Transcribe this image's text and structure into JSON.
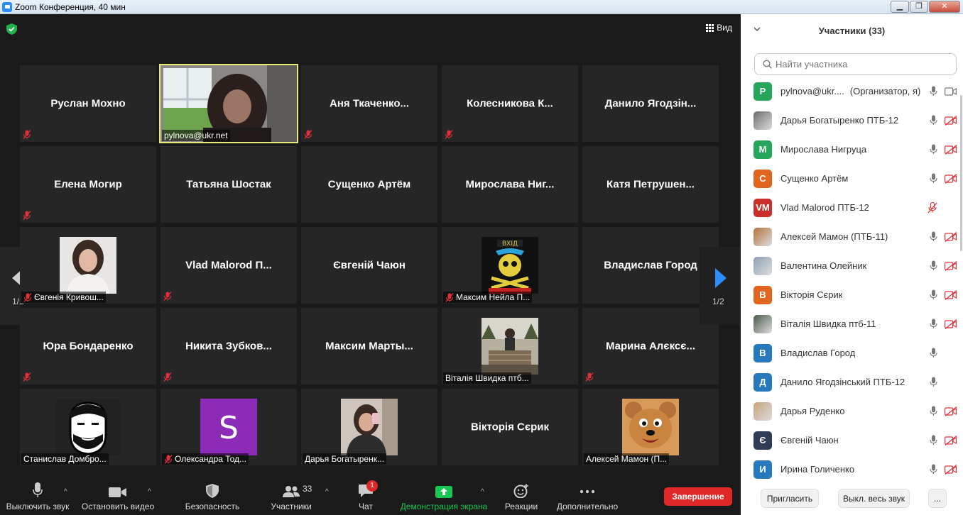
{
  "window": {
    "title": "Zoom Конференция, 40 мин",
    "btn_min": "▁",
    "btn_max": "❐",
    "btn_close": "✕"
  },
  "view_label": "Вид",
  "pager": {
    "page": "1/2"
  },
  "tiles": [
    {
      "name": "Руслан Мохно",
      "muted": true
    },
    {
      "label": "pylnova@ukr.net",
      "active": true,
      "photo": "webcam"
    },
    {
      "name": "Аня  Ткаченко...",
      "muted": true
    },
    {
      "name": "Колесникова  К...",
      "muted": true
    },
    {
      "name": "Данило  Ягодзін..."
    },
    {
      "name": "Елена Могир",
      "muted": true
    },
    {
      "name": "Татьяна Шостак"
    },
    {
      "name": "Сущенко Артём"
    },
    {
      "name": "Мирослава  Ниг..."
    },
    {
      "name": "Катя  Петрушен..."
    },
    {
      "label": "Євгенія Кривош...",
      "muted": true,
      "photo": "girl"
    },
    {
      "name": "Vlad  Malorod  П...",
      "muted": true
    },
    {
      "name": "Євгеній Чаюн"
    },
    {
      "label": "Максим Нейла П...",
      "muted": true,
      "photo": "skull"
    },
    {
      "name": "Владислав Город"
    },
    {
      "name": "Юра Бондаренко",
      "muted": true
    },
    {
      "name": "Никита  Зубков...",
      "muted": true
    },
    {
      "name": "Максим  Марты..."
    },
    {
      "label": "Віталія Швидка птб...",
      "photo": "outdoor"
    },
    {
      "name": "Марина  Алєксє...",
      "muted": true
    },
    {
      "label": "Станислав Домбро...",
      "photo": "beard"
    },
    {
      "label": "Олександра Тод...",
      "muted": true,
      "photo": "letter-s"
    },
    {
      "label": "Дарья Богатыренк...",
      "photo": "selfie"
    },
    {
      "name": "Вікторія Сєрик"
    },
    {
      "label": "Алексей Мамон (П...",
      "photo": "cartoon"
    }
  ],
  "toolbar": {
    "mute": "Выключить звук",
    "video": "Остановить видео",
    "security": "Безопасность",
    "participants": "Участники",
    "participants_count": "33",
    "chat": "Чат",
    "chat_badge": "1",
    "share": "Демонстрация экрана",
    "reactions": "Реакции",
    "more": "Дополнительно",
    "end": "Завершение",
    "caret": "^"
  },
  "panel": {
    "title": "Участники (33)",
    "search_placeholder": "Найти участника",
    "invite": "Пригласить",
    "mute_all": "Выкл. весь звук",
    "more": "...",
    "participants": [
      {
        "initials": "P",
        "color": "#26a65b",
        "name": "pylnova@ukr....",
        "extra": "(Организатор, я)",
        "mic": "on",
        "video": "on"
      },
      {
        "photo": "#6b6b6b",
        "name": "Дарья Богатыренко ПТБ-12",
        "mic": "on",
        "video": "off"
      },
      {
        "initials": "M",
        "color": "#26a65b",
        "name": "Мирослава Нигруца",
        "mic": "on",
        "video": "off"
      },
      {
        "initials": "C",
        "color": "#e0661f",
        "name": "Сущенко Артём",
        "mic": "on",
        "video": "off"
      },
      {
        "initials": "VM",
        "color": "#c9302c",
        "name": "Vlad Malorod ПТБ-12",
        "mic": "off",
        "video": "none"
      },
      {
        "photo": "#b5713a",
        "name": "Алексей Мамон (ПТБ-11)",
        "mic": "on",
        "video": "off"
      },
      {
        "photo": "#8da0b3",
        "name": "Валентина Олейник",
        "mic": "on",
        "video": "off"
      },
      {
        "initials": "B",
        "color": "#e0661f",
        "name": "Вікторія Сєрик",
        "mic": "on",
        "video": "off"
      },
      {
        "photo": "#4b5a4a",
        "name": "Віталія Швидка птб-11",
        "mic": "on",
        "video": "off"
      },
      {
        "initials": "B",
        "color": "#2779bd",
        "name": "Владислав Город",
        "mic": "on",
        "video": "none"
      },
      {
        "initials": "Д",
        "color": "#2779bd",
        "name": "Данило Ягодзінський ПТБ-12",
        "mic": "on",
        "video": "none"
      },
      {
        "photo": "#c8a27c",
        "name": "Дарья Руденко",
        "mic": "on",
        "video": "off"
      },
      {
        "initials": "Є",
        "color": "#2e3d55",
        "name": "Євгеній Чаюн",
        "mic": "on",
        "video": "off"
      },
      {
        "initials": "И",
        "color": "#2779bd",
        "name": "Ирина Голиченко",
        "mic": "on",
        "video": "off"
      }
    ]
  }
}
